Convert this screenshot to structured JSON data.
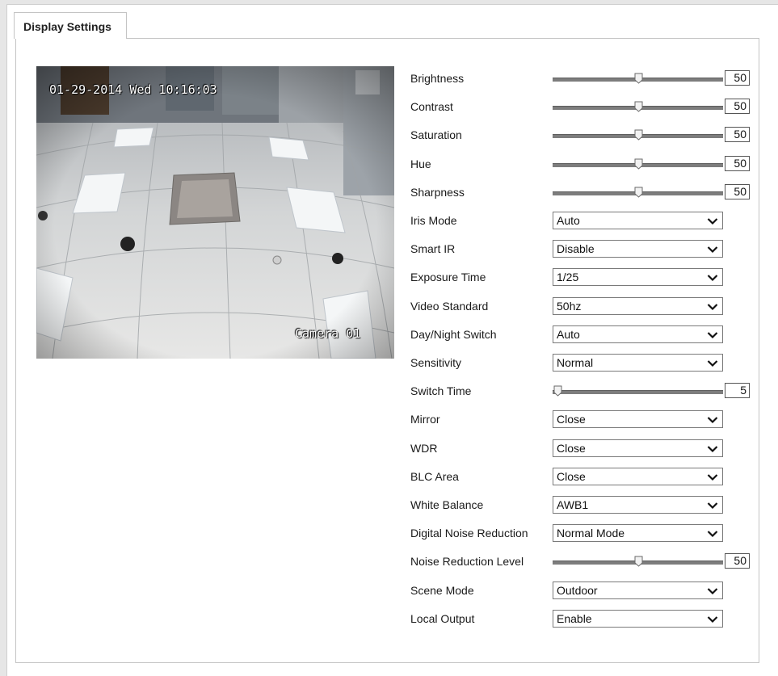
{
  "tab": {
    "label": "Display Settings"
  },
  "preview": {
    "osd_datetime": "01-29-2014 Wed 10:16:03",
    "osd_camera_name": "Camera 01"
  },
  "settings": [
    {
      "id": "brightness",
      "label": "Brightness",
      "kind": "slider",
      "value": "50",
      "min": 0,
      "max": 100
    },
    {
      "id": "contrast",
      "label": "Contrast",
      "kind": "slider",
      "value": "50",
      "min": 0,
      "max": 100
    },
    {
      "id": "saturation",
      "label": "Saturation",
      "kind": "slider",
      "value": "50",
      "min": 0,
      "max": 100
    },
    {
      "id": "hue",
      "label": "Hue",
      "kind": "slider",
      "value": "50",
      "min": 0,
      "max": 100
    },
    {
      "id": "sharpness",
      "label": "Sharpness",
      "kind": "slider",
      "value": "50",
      "min": 0,
      "max": 100
    },
    {
      "id": "iris-mode",
      "label": "Iris Mode",
      "kind": "select",
      "value": "Auto"
    },
    {
      "id": "smart-ir",
      "label": "Smart IR",
      "kind": "select",
      "value": "Disable"
    },
    {
      "id": "exposure-time",
      "label": "Exposure Time",
      "kind": "select",
      "value": "1/25"
    },
    {
      "id": "video-standard",
      "label": "Video Standard",
      "kind": "select",
      "value": "50hz"
    },
    {
      "id": "day-night-switch",
      "label": "Day/Night Switch",
      "kind": "select",
      "value": "Auto"
    },
    {
      "id": "sensitivity",
      "label": "Sensitivity",
      "kind": "select",
      "value": "Normal"
    },
    {
      "id": "switch-time",
      "label": "Switch Time",
      "kind": "slider",
      "value": "5",
      "min": 5,
      "max": 120
    },
    {
      "id": "mirror",
      "label": "Mirror",
      "kind": "select",
      "value": "Close"
    },
    {
      "id": "wdr",
      "label": "WDR",
      "kind": "select",
      "value": "Close"
    },
    {
      "id": "blc-area",
      "label": "BLC Area",
      "kind": "select",
      "value": "Close"
    },
    {
      "id": "white-balance",
      "label": "White Balance",
      "kind": "select",
      "value": "AWB1"
    },
    {
      "id": "digital-noise-reduction",
      "label": "Digital Noise Reduction",
      "kind": "select",
      "value": "Normal Mode"
    },
    {
      "id": "noise-reduction-level",
      "label": "Noise Reduction Level",
      "kind": "slider",
      "value": "50",
      "min": 0,
      "max": 100
    },
    {
      "id": "scene-mode",
      "label": "Scene Mode",
      "kind": "select",
      "value": "Outdoor"
    },
    {
      "id": "local-output",
      "label": "Local Output",
      "kind": "select",
      "value": "Enable"
    }
  ]
}
